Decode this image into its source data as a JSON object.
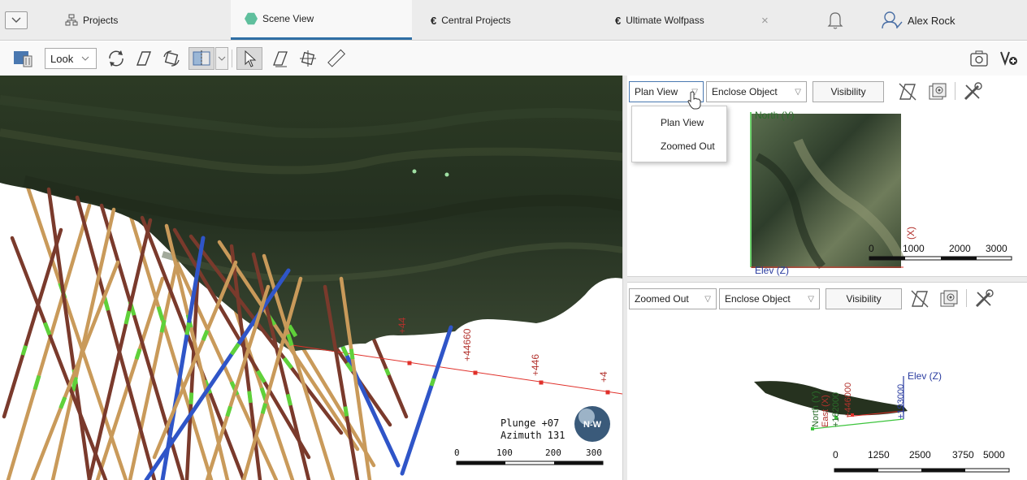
{
  "tabs": [
    {
      "label": "Projects",
      "icon": "projects-icon"
    },
    {
      "label": "Scene View",
      "icon": "scene-hex-icon",
      "active": true
    },
    {
      "label": "Central Projects",
      "icon": "central-icon"
    },
    {
      "label": "Ultimate Wolfpass",
      "icon": "central-icon",
      "close": "×"
    }
  ],
  "user": {
    "name": "Alex Rock"
  },
  "toolbar": {
    "look_label": "Look"
  },
  "scene": {
    "plunge": "Plunge +07",
    "azimuth": "Azimuth 131",
    "scale_ticks": [
      "0",
      "100",
      "200",
      "300"
    ],
    "grid_labels": [
      "+44",
      "+44660",
      "+446",
      "+4"
    ],
    "axis_color": "#e0302a",
    "terrain_color": "#26321f",
    "hole_colors": {
      "brown": "#7a3a2c",
      "tan": "#c99a5a",
      "blue": "#2f55c8",
      "green": "#5fd13a"
    }
  },
  "top_view": {
    "view_select": "Plan View",
    "enclose_select": "Enclose Object",
    "visibility_label": "Visibility",
    "menu_items": [
      "Plan View",
      "Zoomed Out"
    ],
    "north_label": "North (Y)",
    "elev_label": "Elev (Z)",
    "x_label": "(X)",
    "scale_ticks": [
      "0",
      "1000",
      "2000",
      "3000"
    ]
  },
  "bottom_view": {
    "view_select": "Zoomed Out",
    "enclose_select": "Enclose Object",
    "visibility_label": "Visibility",
    "elev_label": "Elev (Z)",
    "east_label": "East (X)",
    "north_label": "North (Y)",
    "coord_a": "+446000",
    "coord_b": "+193000",
    "coord_c": "+182000",
    "scale_ticks": [
      "0",
      "1250",
      "2500",
      "3750",
      "5000"
    ]
  }
}
